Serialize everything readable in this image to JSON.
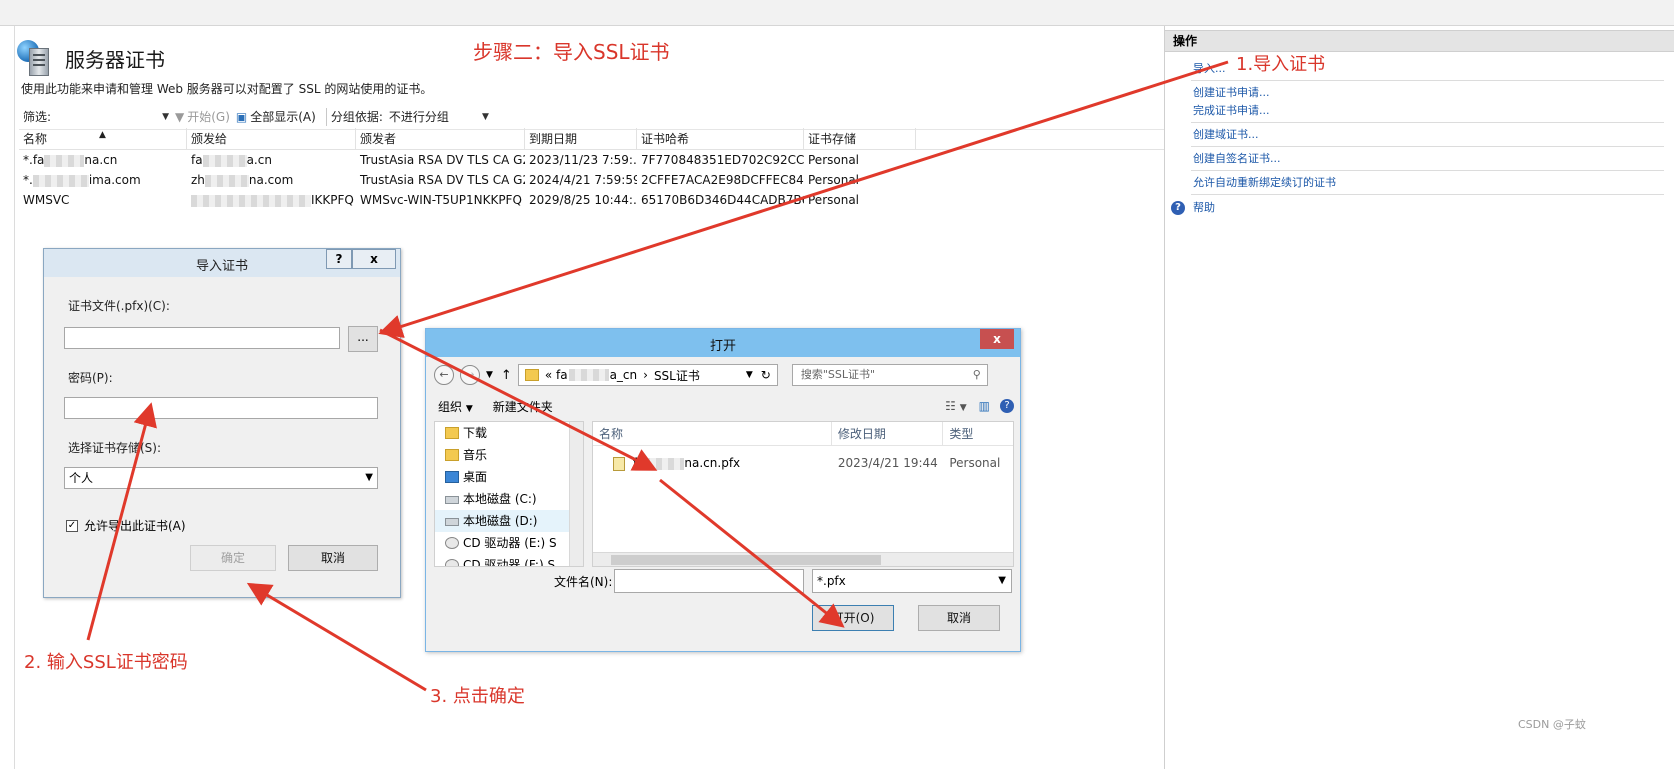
{
  "main": {
    "title": "服务器证书",
    "step_annotation": "步骤二：导入SSL证书",
    "description": "使用此功能来申请和管理 Web 服务器可以对配置了 SSL 的网站使用的证书。",
    "filterbar": {
      "filter_label": "筛选:",
      "start_label": "开始(G)",
      "show_all_label": "全部显示(A)",
      "group_by_label": "分组依据:",
      "group_by_value": "不进行分组"
    },
    "columns": [
      "名称",
      "颁发给",
      "颁发者",
      "到期日期",
      "证书哈希",
      "证书存储"
    ],
    "rows": [
      {
        "name_a": "*.fa",
        "name_b": "na.cn",
        "issued_a": "fa",
        "issued_b": "a.cn",
        "issuer": "TrustAsia RSA DV TLS CA G2",
        "expiry": "2023/11/23 7:59:...",
        "hash": "7F770848351ED702C92CC9...",
        "store": "Personal"
      },
      {
        "name_a": "*.",
        "name_b": "ima.com",
        "issued_a": "zh",
        "issued_b": "na.com",
        "issuer": "TrustAsia RSA DV TLS CA G2",
        "expiry": "2024/4/21 7:59:59",
        "hash": "2CFFE7ACA2E98DCFFEC841",
        "store": "Personal"
      },
      {
        "name_a": "WMSVC",
        "name_b": "",
        "issued_a": "",
        "issued_b": "IKKPFQ",
        "issuer": "WMSvc-WIN-T5UP1NKKPFQ",
        "expiry": "2029/8/25 10:44:...",
        "hash": "65170B6D346D44CADB7B6...",
        "store": "Personal"
      }
    ]
  },
  "actions": {
    "header": "操作",
    "import": "导入...",
    "step1_annotation": "1.导入证书",
    "create_request": "创建证书申请...",
    "complete_request": "完成证书申请...",
    "create_domain": "创建域证书...",
    "create_selfsigned": "创建自签名证书...",
    "auto_rebind": "允许自动重新绑定续订的证书",
    "help": "帮助"
  },
  "import_dialog": {
    "title": "导入证书",
    "help_btn": "?",
    "close_btn": "x",
    "file_label": "证书文件(.pfx)(C):",
    "browse_label": "...",
    "password_label": "密码(P):",
    "store_label": "选择证书存储(S):",
    "store_value": "个人",
    "allow_export_label": "允许导出此证书(A)",
    "ok_label": "确定",
    "cancel_label": "取消"
  },
  "open_dialog": {
    "title": "打开",
    "close_btn": "x",
    "address_a": "«  fa",
    "address_b": "a_cn",
    "address_c": "SSL证书",
    "search_placeholder": "搜索\"SSL证书\"",
    "organize": "组织",
    "new_folder": "新建文件夹",
    "tree": [
      "下载",
      "音乐",
      "桌面",
      "本地磁盘 (C:)",
      "本地磁盘 (D:)",
      "CD 驱动器 (E:) S",
      "CD 驱动器 (F:) S"
    ],
    "col_name": "名称",
    "col_modified": "修改日期",
    "col_type": "类型",
    "file_name_a": "fa",
    "file_name_b": "na.cn.pfx",
    "file_modified": "2023/4/21 19:44",
    "file_type": "Personal",
    "filename_label": "文件名(N):",
    "filter_value": "*.pfx",
    "open_label": "打开(O)",
    "cancel_label": "取消"
  },
  "annotations": {
    "step2_password": "2. 输入SSL证书密码",
    "step3_confirm": "3. 点击确定"
  },
  "watermark": "CSDN @子蚊",
  "colors": {
    "annotation": "#d9362b",
    "link": "#1b57a8",
    "open_titlebar": "#7ec0ee"
  }
}
